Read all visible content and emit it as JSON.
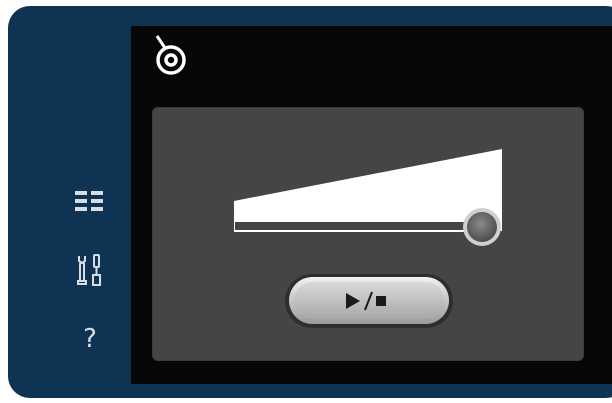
{
  "sidebar": {
    "menu_icon": "menu-list-icon",
    "settings_icon": "wrench-screwdriver-icon",
    "help_label": "?"
  },
  "header": {
    "thread_icon": "thread-spool-icon"
  },
  "speed_control": {
    "icon": "speed-slider",
    "level": 0.89
  },
  "start_stop_button": {
    "icon": "play-stop-icon"
  },
  "colors": {
    "bezel": "#0f3352",
    "screen": "#070707",
    "panel": "#454545",
    "icon": "#d8dde3"
  }
}
